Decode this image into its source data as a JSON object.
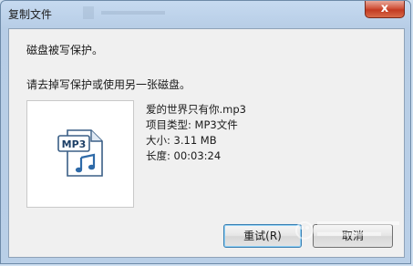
{
  "window": {
    "title": "复制文件",
    "close_symbol": "x"
  },
  "message": {
    "line1": "磁盘被写保护。",
    "line2": "请去掉写保护或使用另一张磁盘。"
  },
  "file": {
    "icon": "mp3-file-icon",
    "icon_label": "MP3",
    "name": "爱的世界只有你.mp3",
    "type": "项目类型: MP3文件",
    "size": "大小: 3.11 MB",
    "duration": "长度: 00:03:24"
  },
  "buttons": {
    "retry": "重试(R)",
    "cancel": "取消"
  },
  "colors": {
    "close_button": "#c23a22",
    "focus_border": "#3c7fb1"
  }
}
